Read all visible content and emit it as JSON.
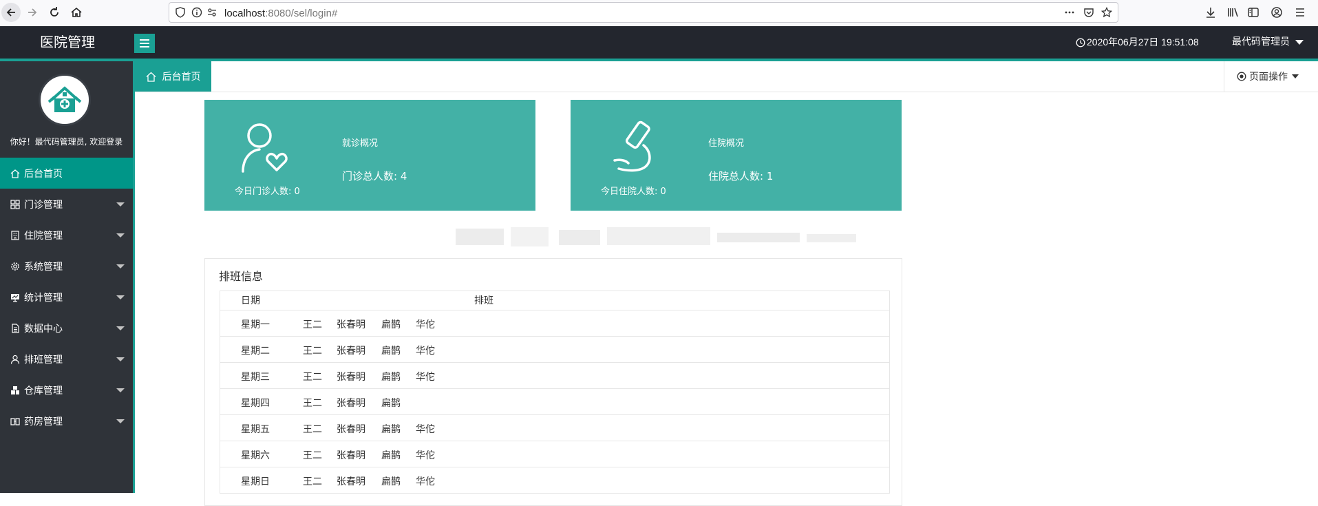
{
  "browser": {
    "url_host": "localhost",
    "url_rest": ":8080/sel/login#"
  },
  "header": {
    "app_title": "医院管理",
    "datetime": "2020年06月27日 19:51:08",
    "admin_name": "最代码管理员"
  },
  "sidebar": {
    "welcome": "你好！最代码管理员, 欢迎登录",
    "items": [
      {
        "label": "后台首页",
        "icon": "home-icon"
      },
      {
        "label": "门诊管理",
        "icon": "grid-icon"
      },
      {
        "label": "住院管理",
        "icon": "building-icon"
      },
      {
        "label": "系统管理",
        "icon": "gear-icon"
      },
      {
        "label": "统计管理",
        "icon": "chart-board-icon"
      },
      {
        "label": "数据中心",
        "icon": "document-icon"
      },
      {
        "label": "排班管理",
        "icon": "user-icon"
      },
      {
        "label": "仓库管理",
        "icon": "warehouse-icon"
      },
      {
        "label": "药房管理",
        "icon": "pharmacy-icon"
      }
    ]
  },
  "tabbar": {
    "home_tab": "后台首页",
    "page_ops": "页面操作"
  },
  "cards": [
    {
      "title": "就诊概况",
      "total": "门诊总人数: 4",
      "today": "今日门诊人数: 0",
      "icon": "user-heart-icon"
    },
    {
      "title": "住院概况",
      "total": "住院总人数: 1",
      "today": "今日住院人数: 0",
      "icon": "microscope-icon"
    }
  ],
  "schedule": {
    "title": "排班信息",
    "headers": [
      "日期",
      "排班"
    ],
    "rows": [
      {
        "day": "星期一",
        "names": [
          "王二",
          "张春明",
          "扁鹊",
          "华佗"
        ]
      },
      {
        "day": "星期二",
        "names": [
          "王二",
          "张春明",
          "扁鹊",
          "华佗"
        ]
      },
      {
        "day": "星期三",
        "names": [
          "王二",
          "张春明",
          "扁鹊",
          "华佗"
        ]
      },
      {
        "day": "星期四",
        "names": [
          "王二",
          "张春明",
          "扁鹊",
          ""
        ]
      },
      {
        "day": "星期五",
        "names": [
          "王二",
          "张春明",
          "扁鹊",
          "华佗"
        ]
      },
      {
        "day": "星期六",
        "names": [
          "王二",
          "张春明",
          "扁鹊",
          "华佗"
        ]
      },
      {
        "day": "星期日",
        "names": [
          "王二",
          "张春明",
          "扁鹊",
          "华佗"
        ]
      }
    ]
  },
  "colors": {
    "accent": "#1aa094",
    "header_bg": "#23262e",
    "sidebar_bg": "#2f3339",
    "card_bg": "#43b1a6"
  }
}
